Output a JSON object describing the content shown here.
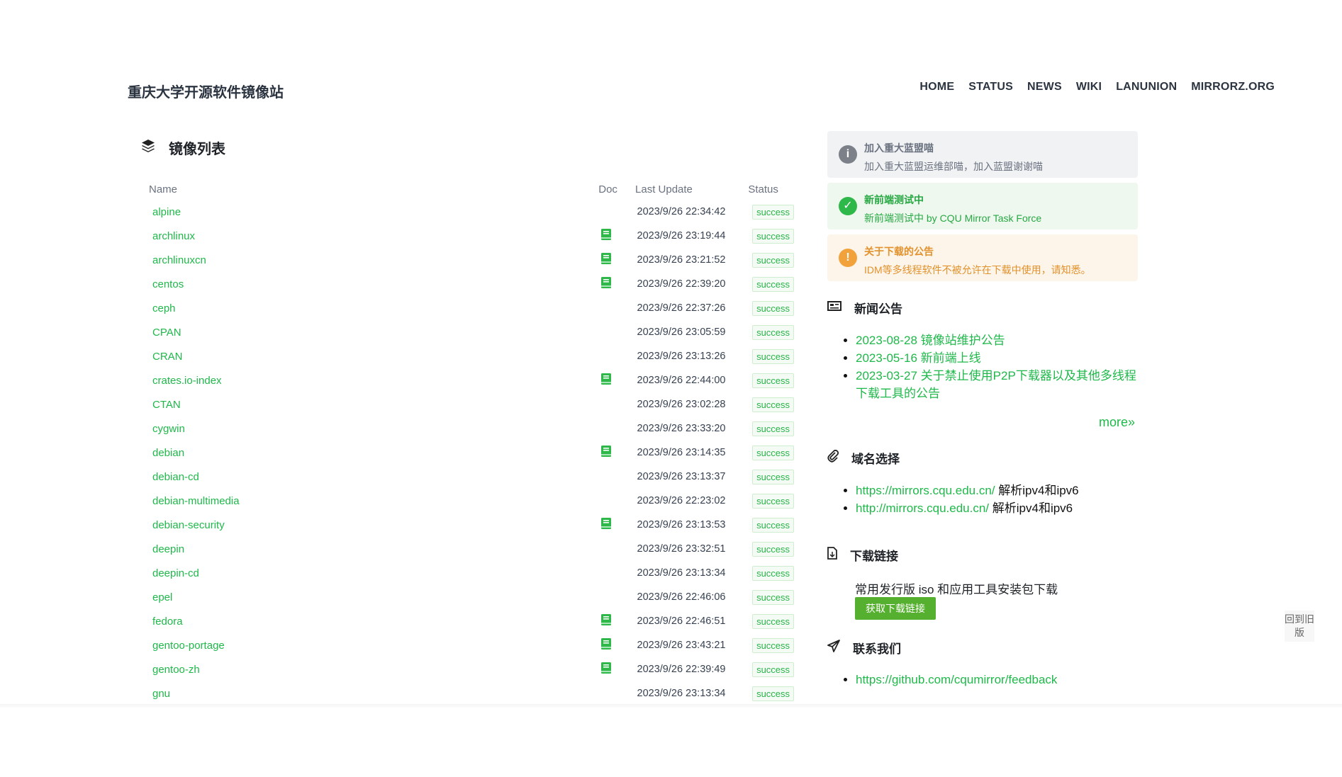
{
  "site_title": "重庆大学开源软件镜像站",
  "nav": [
    "HOME",
    "STATUS",
    "NEWS",
    "WIKI",
    "LANUNION",
    "MIRRORZ.ORG"
  ],
  "mirror_list": {
    "title": "镜像列表",
    "columns": {
      "name": "Name",
      "doc": "Doc",
      "last_update": "Last Update",
      "status": "Status"
    },
    "rows": [
      {
        "name": "alpine",
        "doc": false,
        "updated": "2023/9/26 22:34:42",
        "status": "success"
      },
      {
        "name": "archlinux",
        "doc": true,
        "updated": "2023/9/26 23:19:44",
        "status": "success"
      },
      {
        "name": "archlinuxcn",
        "doc": true,
        "updated": "2023/9/26 23:21:52",
        "status": "success"
      },
      {
        "name": "centos",
        "doc": true,
        "updated": "2023/9/26 22:39:20",
        "status": "success"
      },
      {
        "name": "ceph",
        "doc": false,
        "updated": "2023/9/26 22:37:26",
        "status": "success"
      },
      {
        "name": "CPAN",
        "doc": false,
        "updated": "2023/9/26 23:05:59",
        "status": "success"
      },
      {
        "name": "CRAN",
        "doc": false,
        "updated": "2023/9/26 23:13:26",
        "status": "success"
      },
      {
        "name": "crates.io-index",
        "doc": true,
        "updated": "2023/9/26 22:44:00",
        "status": "success"
      },
      {
        "name": "CTAN",
        "doc": false,
        "updated": "2023/9/26 23:02:28",
        "status": "success"
      },
      {
        "name": "cygwin",
        "doc": false,
        "updated": "2023/9/26 23:33:20",
        "status": "success"
      },
      {
        "name": "debian",
        "doc": true,
        "updated": "2023/9/26 23:14:35",
        "status": "success"
      },
      {
        "name": "debian-cd",
        "doc": false,
        "updated": "2023/9/26 23:13:37",
        "status": "success"
      },
      {
        "name": "debian-multimedia",
        "doc": false,
        "updated": "2023/9/26 22:23:02",
        "status": "success"
      },
      {
        "name": "debian-security",
        "doc": true,
        "updated": "2023/9/26 23:13:53",
        "status": "success"
      },
      {
        "name": "deepin",
        "doc": false,
        "updated": "2023/9/26 23:32:51",
        "status": "success"
      },
      {
        "name": "deepin-cd",
        "doc": false,
        "updated": "2023/9/26 23:13:34",
        "status": "success"
      },
      {
        "name": "epel",
        "doc": false,
        "updated": "2023/9/26 22:46:06",
        "status": "success"
      },
      {
        "name": "fedora",
        "doc": true,
        "updated": "2023/9/26 22:46:51",
        "status": "success"
      },
      {
        "name": "gentoo-portage",
        "doc": true,
        "updated": "2023/9/26 23:43:21",
        "status": "success"
      },
      {
        "name": "gentoo-zh",
        "doc": true,
        "updated": "2023/9/26 22:39:49",
        "status": "success"
      },
      {
        "name": "gnu",
        "doc": false,
        "updated": "2023/9/26 23:13:34",
        "status": "success"
      }
    ]
  },
  "alerts": {
    "info": {
      "title": "加入重大蓝盟喵",
      "desc": "加入重大蓝盟运维部喵，加入蓝盟谢谢喵"
    },
    "success": {
      "title": "新前端测试中",
      "desc": "新前端测试中 by CQU Mirror Task Force"
    },
    "warning": {
      "title": "关于下载的公告",
      "desc": "IDM等多线程软件不被允许在下载中使用，请知悉。"
    }
  },
  "news": {
    "title": "新闻公告",
    "items": [
      "2023-08-28 镜像站维护公告",
      "2023-05-16 新前端上线",
      "2023-03-27 关于禁止使用P2P下载器以及其他多线程下载工具的公告"
    ],
    "more": "more»"
  },
  "domains": {
    "title": "域名选择",
    "items": [
      {
        "url": "https://mirrors.cqu.edu.cn/",
        "note": "解析ipv4和ipv6"
      },
      {
        "url": "http://mirrors.cqu.edu.cn/",
        "note": "解析ipv4和ipv6"
      }
    ]
  },
  "downloads": {
    "title": "下载链接",
    "text": "常用发行版 iso 和应用工具安装包下载",
    "button": "获取下载链接"
  },
  "contact": {
    "title": "联系我们",
    "link": "https://github.com/cqumirror/feedback"
  },
  "old_version": "回到旧版",
  "colors": {
    "accent": "#1fb84a",
    "button": "#56b02f",
    "info": "#7b8089",
    "warning": "#f2a23a"
  }
}
